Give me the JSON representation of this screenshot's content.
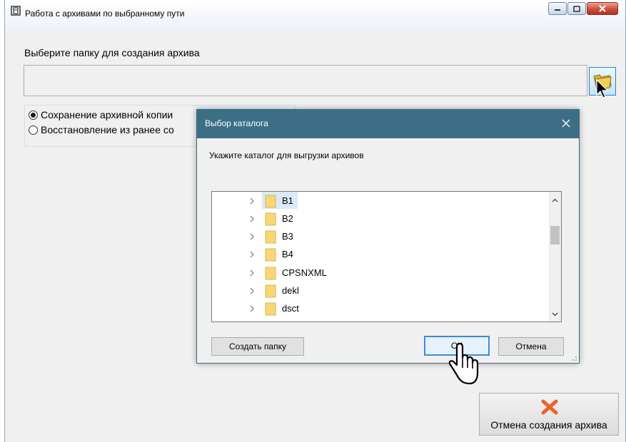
{
  "window": {
    "title": "Работа с архивами по выбранному пути",
    "select_label": "Выберите папку для создания архива",
    "path_value": "",
    "radios": [
      {
        "label": "Сохранение архивной копии",
        "checked": true
      },
      {
        "label": "Восстановление из ранее со",
        "checked": false
      }
    ],
    "cancel_button_label": "Отмена создания архива"
  },
  "dialog": {
    "title": "Выбор каталога",
    "prompt": "Укажите каталог для выгрузки архивов",
    "tree_items": [
      {
        "name": "B1",
        "selected": true
      },
      {
        "name": "B2",
        "selected": false
      },
      {
        "name": "B3",
        "selected": false
      },
      {
        "name": "B4",
        "selected": false
      },
      {
        "name": "CPSNXML",
        "selected": false
      },
      {
        "name": "dekl",
        "selected": false
      },
      {
        "name": "dsct",
        "selected": false
      }
    ],
    "create_folder_label": "Создать папку",
    "ok_label": "ОК",
    "cancel_label": "Отмена"
  },
  "colors": {
    "dialog_title_bg": "#3c6f86",
    "selection": "#d9ebf9",
    "folder": "#f8d775",
    "cancel_x": "#e8632a"
  }
}
